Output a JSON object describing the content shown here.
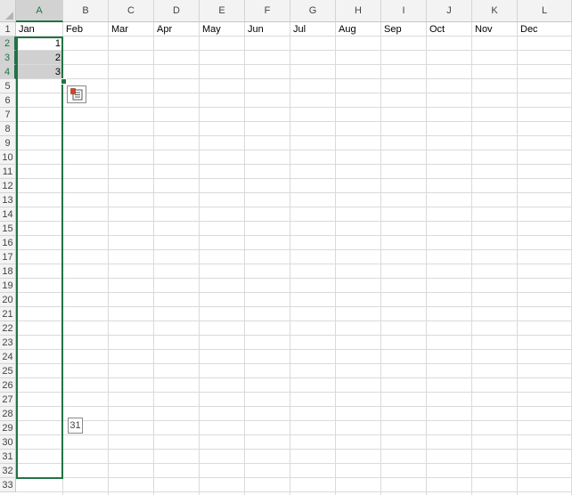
{
  "columns": [
    "A",
    "B",
    "C",
    "D",
    "E",
    "F",
    "G",
    "H",
    "I",
    "J",
    "K",
    "L"
  ],
  "rows": [
    "1",
    "2",
    "3",
    "4",
    "5",
    "6",
    "7",
    "8",
    "9",
    "10",
    "11",
    "12",
    "13",
    "14",
    "15",
    "16",
    "17",
    "18",
    "19",
    "20",
    "21",
    "22",
    "23",
    "24",
    "25",
    "26",
    "27",
    "28",
    "29",
    "30",
    "31",
    "32",
    "33"
  ],
  "selected_column": "A",
  "selected_rows": [
    "2",
    "3",
    "4"
  ],
  "row1_months": [
    "Jan",
    "Feb",
    "Mar",
    "Apr",
    "May",
    "Jun",
    "Jul",
    "Aug",
    "Sep",
    "Oct",
    "Nov",
    "Dec"
  ],
  "columnA_values": [
    "1",
    "2",
    "3"
  ],
  "autofill_tooltip": "31",
  "quick_analysis_icon": "auto-fill-options-icon",
  "colors": {
    "selection": "#217346",
    "fill": "#d0d0d0",
    "header_bg": "#f3f3f3"
  }
}
